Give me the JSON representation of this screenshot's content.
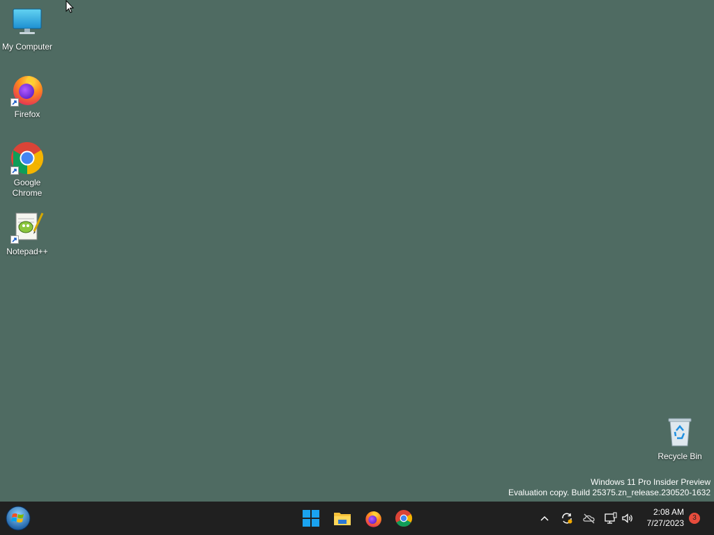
{
  "desktop": {
    "icons": [
      {
        "label": "My Computer",
        "icon": "monitor-icon"
      },
      {
        "label": "Firefox",
        "icon": "firefox-icon"
      },
      {
        "label": "Google Chrome",
        "icon": "chrome-icon"
      },
      {
        "label": "Notepad++",
        "icon": "notepadpp-icon"
      },
      {
        "label": "Recycle Bin",
        "icon": "recycle-bin-icon"
      }
    ]
  },
  "watermark": {
    "line1": "Windows 11 Pro Insider Preview",
    "line2": "Evaluation copy. Build 25375.zn_release.230520-1632"
  },
  "taskbar": {
    "pinned": [
      "windows-start-icon",
      "file-explorer-icon",
      "firefox-icon",
      "chrome-icon"
    ],
    "tray": [
      "chevron-up-icon",
      "sync-icon",
      "onedrive-offline-icon",
      "network-icon",
      "volume-icon"
    ],
    "time": "2:08 AM",
    "date": "7/27/2023",
    "notification_count": "3"
  },
  "colors": {
    "desktop_background": "#4f6b62",
    "taskbar_background": "#202020"
  }
}
